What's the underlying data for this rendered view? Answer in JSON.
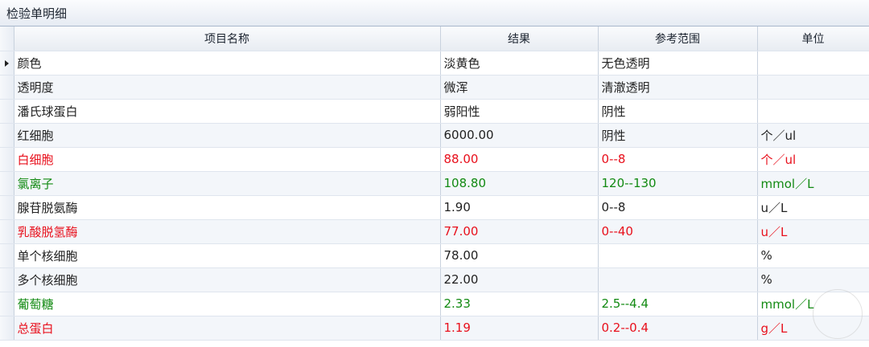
{
  "window": {
    "title": "检验单明细"
  },
  "table": {
    "columns": [
      "项目名称",
      "结果",
      "参考范围",
      "单位"
    ],
    "rows": [
      {
        "name": "颜色",
        "result": "淡黄色",
        "range": "无色透明",
        "unit": "",
        "color": "black"
      },
      {
        "name": "透明度",
        "result": "微浑",
        "range": "清澈透明",
        "unit": "",
        "color": "black"
      },
      {
        "name": "潘氏球蛋白",
        "result": "弱阳性",
        "range": "阴性",
        "unit": "",
        "color": "black"
      },
      {
        "name": "红细胞",
        "result": "6000.00",
        "range": "阴性",
        "unit": "个／ul",
        "color": "black"
      },
      {
        "name": "白细胞",
        "result": "88.00",
        "range": "0--8",
        "unit": "个／ul",
        "color": "red"
      },
      {
        "name": "氯离子",
        "result": "108.80",
        "range": "120--130",
        "unit": "mmol／L",
        "color": "green"
      },
      {
        "name": "腺苷脱氨酶",
        "result": "1.90",
        "range": "0--8",
        "unit": "u／L",
        "color": "black"
      },
      {
        "name": "乳酸脱氢酶",
        "result": "77.00",
        "range": "0--40",
        "unit": "u／L",
        "color": "red"
      },
      {
        "name": "单个核细胞",
        "result": "78.00",
        "range": "",
        "unit": "%",
        "color": "black"
      },
      {
        "name": "多个核细胞",
        "result": "22.00",
        "range": "",
        "unit": "%",
        "color": "black"
      },
      {
        "name": "葡萄糖",
        "result": "2.33",
        "range": "2.5--4.4",
        "unit": "mmol／L",
        "color": "green"
      },
      {
        "name": "总蛋白",
        "result": "1.19",
        "range": "0.2--0.4",
        "unit": "g／L",
        "color": "red"
      }
    ]
  },
  "colors": {
    "high": "#e8101c",
    "low": "#128a12",
    "normal": "#222222"
  }
}
